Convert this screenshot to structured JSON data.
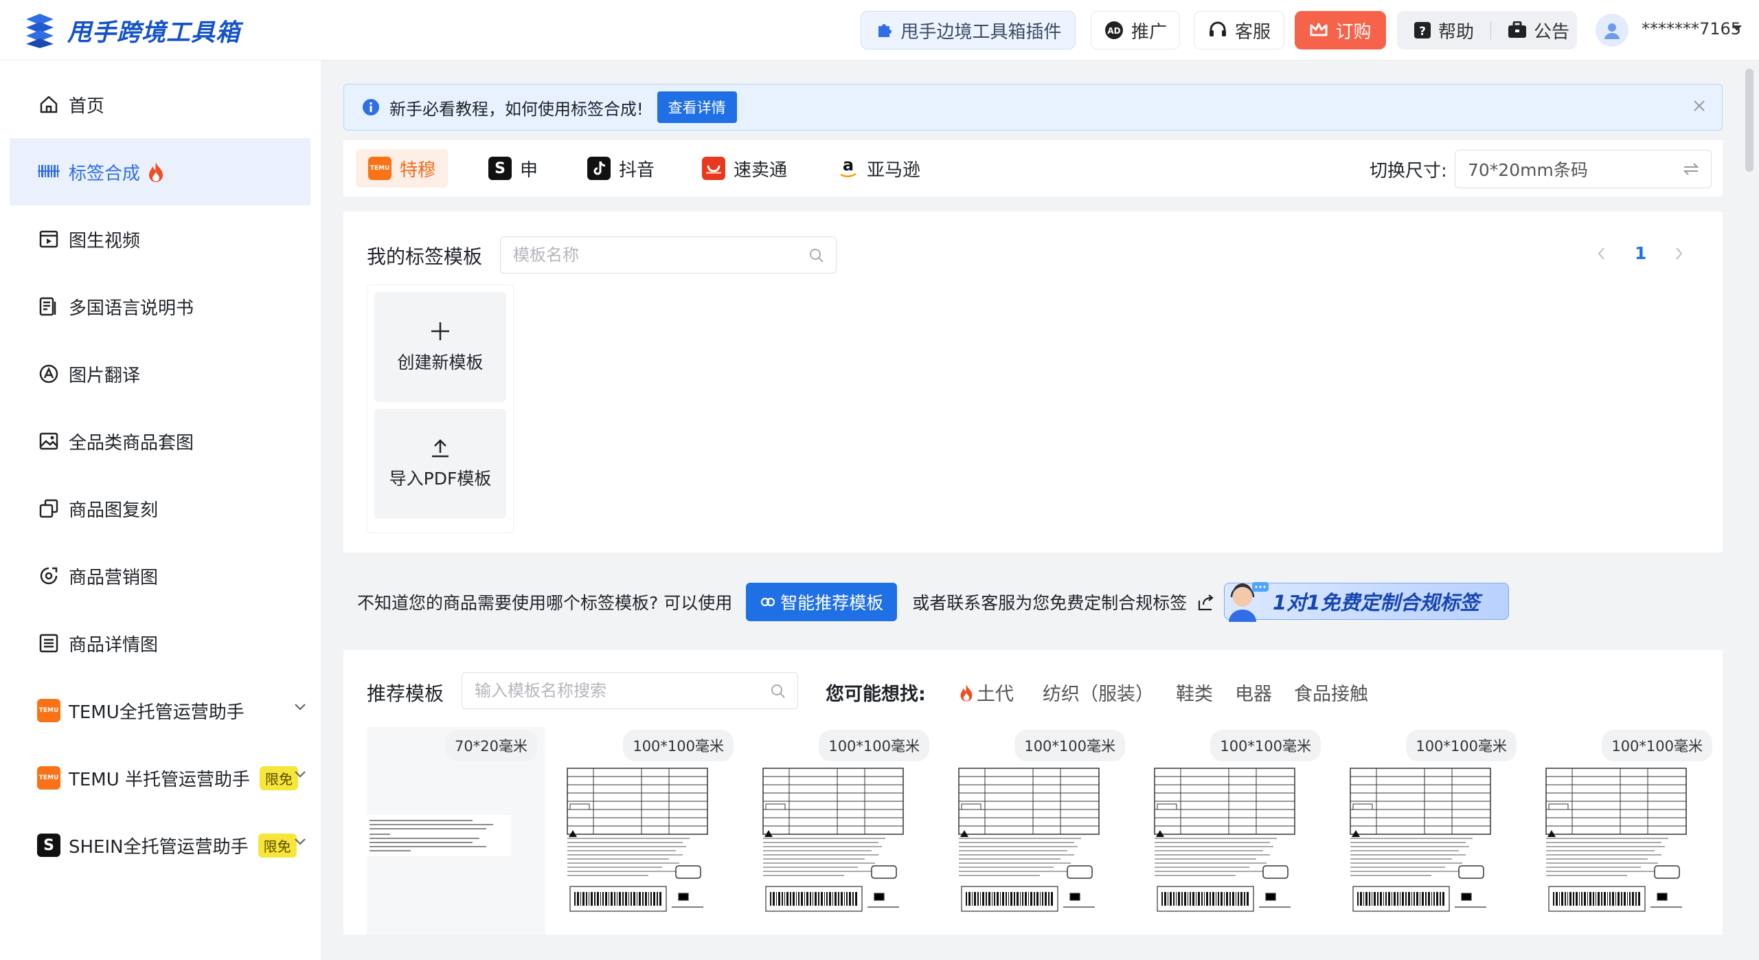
{
  "app": {
    "title": "甩手跨境工具箱"
  },
  "header": {
    "plugin_label": "甩手边境工具箱插件",
    "promo_label": "推广",
    "cs_label": "客服",
    "order_label": "订购",
    "help_label": "帮助",
    "announce_label": "公告",
    "username": "*******7165",
    "accent": "#1f6fe5",
    "order_color": "#f5634a"
  },
  "sidebar": {
    "items": [
      {
        "label": "首页",
        "icon": "home-icon"
      },
      {
        "label": "标签合成",
        "icon": "barcode-icon",
        "active": true
      },
      {
        "label": "图生视频",
        "icon": "video-icon"
      },
      {
        "label": "多国语言说明书",
        "icon": "manual-icon"
      },
      {
        "label": "图片翻译",
        "icon": "translate-icon"
      },
      {
        "label": "全品类商品套图",
        "icon": "image-icon"
      },
      {
        "label": "商品图复刻",
        "icon": "copy-icon"
      },
      {
        "label": "商品营销图",
        "icon": "marketing-icon"
      },
      {
        "label": "商品详情图",
        "icon": "detail-icon"
      },
      {
        "label": "TEMU全托管运营助手",
        "icon": "temu-icon"
      },
      {
        "label": "TEMU 半托管运营助手",
        "icon": "temu-icon",
        "badge": "限免"
      },
      {
        "label": "SHEIN全托管运营助手",
        "icon": "shein-icon",
        "badge": "限免"
      }
    ]
  },
  "notice": {
    "text": "新手必看教程，如何使用标签合成!",
    "button": "查看详情"
  },
  "platform_tabs": [
    {
      "label": "特穆",
      "active": true
    },
    {
      "label": "申"
    },
    {
      "label": "抖音"
    },
    {
      "label": "速卖通"
    },
    {
      "label": "亚马逊"
    }
  ],
  "size": {
    "label": "切换尺寸:",
    "value": "70*20mm条码"
  },
  "my_templates": {
    "title": "我的标签模板",
    "search_placeholder": "模板名称",
    "page": "1",
    "create_label": "创建新模板",
    "import_label": "导入PDF模板"
  },
  "recommend_line": {
    "text1": "不知道您的商品需要使用哪个标签模板? 可以使用",
    "smart_button": "智能推荐模板",
    "text2": "或者联系客服为您免费定制合规标签",
    "banner": "1对1免费定制合规标签"
  },
  "recommended": {
    "title": "推荐模板",
    "search_placeholder": "输入模板名称搜索",
    "maybe_label": "您可能想找:",
    "tags": [
      "土代",
      "纺织（服装）",
      "鞋类",
      "电器",
      "食品接触"
    ],
    "thumbs": [
      {
        "size": "70*20毫米"
      },
      {
        "size": "100*100毫米"
      },
      {
        "size": "100*100毫米"
      },
      {
        "size": "100*100毫米"
      },
      {
        "size": "100*100毫米"
      },
      {
        "size": "100*100毫米"
      },
      {
        "size": "100*100毫米"
      }
    ]
  }
}
